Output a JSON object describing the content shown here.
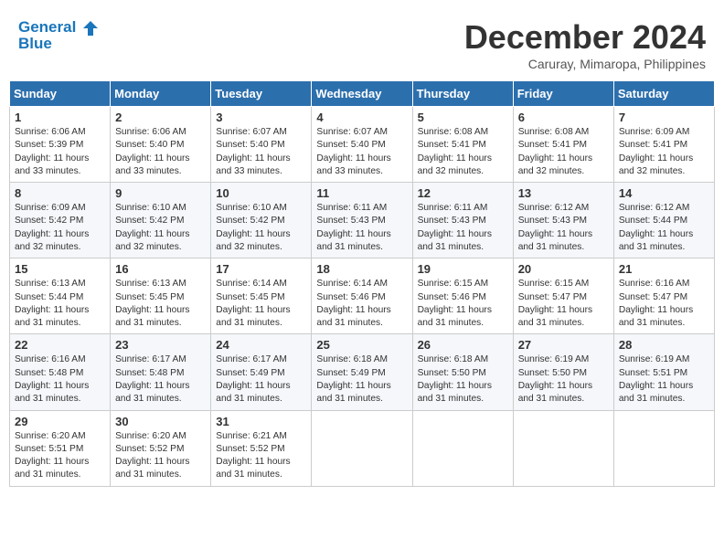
{
  "header": {
    "logo_line1": "General",
    "logo_line2": "Blue",
    "month_title": "December 2024",
    "subtitle": "Caruray, Mimaropa, Philippines"
  },
  "weekdays": [
    "Sunday",
    "Monday",
    "Tuesday",
    "Wednesday",
    "Thursday",
    "Friday",
    "Saturday"
  ],
  "weeks": [
    [
      {
        "day": "1",
        "info": "Sunrise: 6:06 AM\nSunset: 5:39 PM\nDaylight: 11 hours\nand 33 minutes."
      },
      {
        "day": "2",
        "info": "Sunrise: 6:06 AM\nSunset: 5:40 PM\nDaylight: 11 hours\nand 33 minutes."
      },
      {
        "day": "3",
        "info": "Sunrise: 6:07 AM\nSunset: 5:40 PM\nDaylight: 11 hours\nand 33 minutes."
      },
      {
        "day": "4",
        "info": "Sunrise: 6:07 AM\nSunset: 5:40 PM\nDaylight: 11 hours\nand 33 minutes."
      },
      {
        "day": "5",
        "info": "Sunrise: 6:08 AM\nSunset: 5:41 PM\nDaylight: 11 hours\nand 32 minutes."
      },
      {
        "day": "6",
        "info": "Sunrise: 6:08 AM\nSunset: 5:41 PM\nDaylight: 11 hours\nand 32 minutes."
      },
      {
        "day": "7",
        "info": "Sunrise: 6:09 AM\nSunset: 5:41 PM\nDaylight: 11 hours\nand 32 minutes."
      }
    ],
    [
      {
        "day": "8",
        "info": "Sunrise: 6:09 AM\nSunset: 5:42 PM\nDaylight: 11 hours\nand 32 minutes."
      },
      {
        "day": "9",
        "info": "Sunrise: 6:10 AM\nSunset: 5:42 PM\nDaylight: 11 hours\nand 32 minutes."
      },
      {
        "day": "10",
        "info": "Sunrise: 6:10 AM\nSunset: 5:42 PM\nDaylight: 11 hours\nand 32 minutes."
      },
      {
        "day": "11",
        "info": "Sunrise: 6:11 AM\nSunset: 5:43 PM\nDaylight: 11 hours\nand 31 minutes."
      },
      {
        "day": "12",
        "info": "Sunrise: 6:11 AM\nSunset: 5:43 PM\nDaylight: 11 hours\nand 31 minutes."
      },
      {
        "day": "13",
        "info": "Sunrise: 6:12 AM\nSunset: 5:43 PM\nDaylight: 11 hours\nand 31 minutes."
      },
      {
        "day": "14",
        "info": "Sunrise: 6:12 AM\nSunset: 5:44 PM\nDaylight: 11 hours\nand 31 minutes."
      }
    ],
    [
      {
        "day": "15",
        "info": "Sunrise: 6:13 AM\nSunset: 5:44 PM\nDaylight: 11 hours\nand 31 minutes."
      },
      {
        "day": "16",
        "info": "Sunrise: 6:13 AM\nSunset: 5:45 PM\nDaylight: 11 hours\nand 31 minutes."
      },
      {
        "day": "17",
        "info": "Sunrise: 6:14 AM\nSunset: 5:45 PM\nDaylight: 11 hours\nand 31 minutes."
      },
      {
        "day": "18",
        "info": "Sunrise: 6:14 AM\nSunset: 5:46 PM\nDaylight: 11 hours\nand 31 minutes."
      },
      {
        "day": "19",
        "info": "Sunrise: 6:15 AM\nSunset: 5:46 PM\nDaylight: 11 hours\nand 31 minutes."
      },
      {
        "day": "20",
        "info": "Sunrise: 6:15 AM\nSunset: 5:47 PM\nDaylight: 11 hours\nand 31 minutes."
      },
      {
        "day": "21",
        "info": "Sunrise: 6:16 AM\nSunset: 5:47 PM\nDaylight: 11 hours\nand 31 minutes."
      }
    ],
    [
      {
        "day": "22",
        "info": "Sunrise: 6:16 AM\nSunset: 5:48 PM\nDaylight: 11 hours\nand 31 minutes."
      },
      {
        "day": "23",
        "info": "Sunrise: 6:17 AM\nSunset: 5:48 PM\nDaylight: 11 hours\nand 31 minutes."
      },
      {
        "day": "24",
        "info": "Sunrise: 6:17 AM\nSunset: 5:49 PM\nDaylight: 11 hours\nand 31 minutes."
      },
      {
        "day": "25",
        "info": "Sunrise: 6:18 AM\nSunset: 5:49 PM\nDaylight: 11 hours\nand 31 minutes."
      },
      {
        "day": "26",
        "info": "Sunrise: 6:18 AM\nSunset: 5:50 PM\nDaylight: 11 hours\nand 31 minutes."
      },
      {
        "day": "27",
        "info": "Sunrise: 6:19 AM\nSunset: 5:50 PM\nDaylight: 11 hours\nand 31 minutes."
      },
      {
        "day": "28",
        "info": "Sunrise: 6:19 AM\nSunset: 5:51 PM\nDaylight: 11 hours\nand 31 minutes."
      }
    ],
    [
      {
        "day": "29",
        "info": "Sunrise: 6:20 AM\nSunset: 5:51 PM\nDaylight: 11 hours\nand 31 minutes."
      },
      {
        "day": "30",
        "info": "Sunrise: 6:20 AM\nSunset: 5:52 PM\nDaylight: 11 hours\nand 31 minutes."
      },
      {
        "day": "31",
        "info": "Sunrise: 6:21 AM\nSunset: 5:52 PM\nDaylight: 11 hours\nand 31 minutes."
      },
      {
        "day": "",
        "info": ""
      },
      {
        "day": "",
        "info": ""
      },
      {
        "day": "",
        "info": ""
      },
      {
        "day": "",
        "info": ""
      }
    ]
  ]
}
